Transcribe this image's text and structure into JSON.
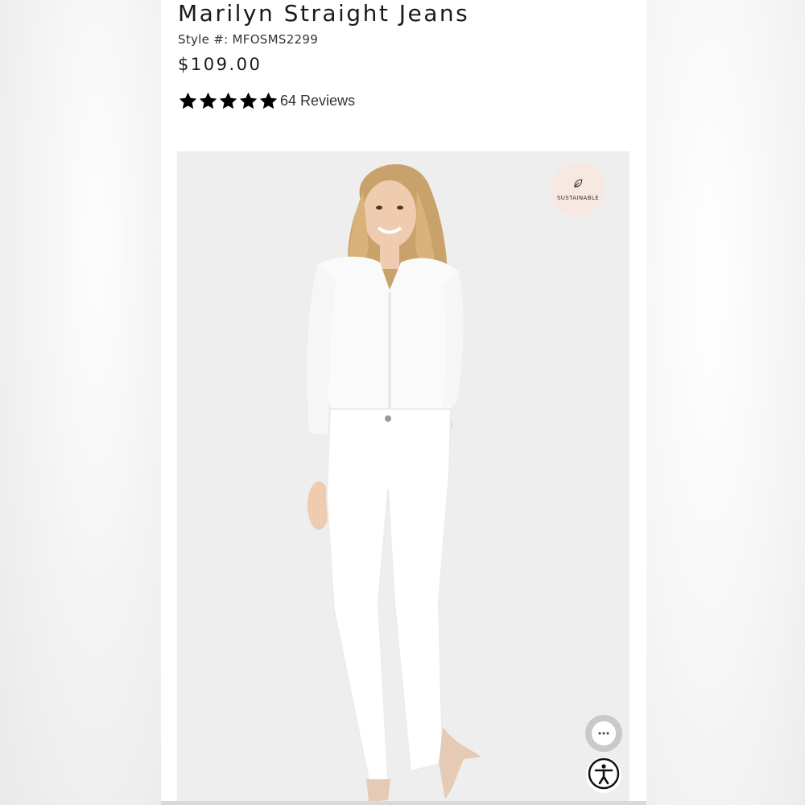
{
  "product": {
    "title": "Marilyn Straight Jeans",
    "style_number": "Style #: MFOSMS2299",
    "price": "$109.00",
    "rating": {
      "stars": 5,
      "max": 5,
      "reviews_label": "64 Reviews"
    }
  },
  "image": {
    "badge_label": "SUSTAINABLE",
    "badge_icon": "leaf-icon",
    "description_alt": "Model wearing white blouse and white straight jeans"
  },
  "floating_buttons": {
    "chat_icon": "chat-icon",
    "accessibility_icon": "accessibility-icon"
  },
  "colors": {
    "image_bg": "#eeeeee",
    "badge_bg": "#f7e9e2",
    "star": "#000000"
  }
}
